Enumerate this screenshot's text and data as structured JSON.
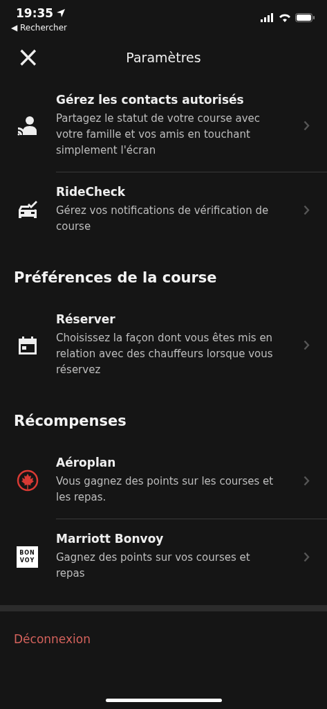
{
  "status_bar": {
    "time": "19:35",
    "back_label": "◀ Rechercher"
  },
  "header": {
    "close": "×",
    "title": "Paramètres"
  },
  "sections": [
    {
      "items": [
        {
          "kind": "contacts",
          "title": "Gérez les contacts autorisés",
          "description": "Partagez le statut de votre course avec votre famille et vos amis en touchant simplement l'écran"
        },
        {
          "kind": "car_check",
          "title": "RideCheck",
          "description": "Gérez vos notifications de vérification de course"
        }
      ]
    },
    {
      "heading": "Préférences de la course",
      "items": [
        {
          "kind": "calendar",
          "title": "Réserver",
          "description": "Choisissez la façon dont vous êtes mis en relation avec des chauffeurs lorsque vous réservez"
        }
      ]
    },
    {
      "heading": "Récompenses",
      "items": [
        {
          "kind": "maple",
          "title": "Aéroplan",
          "description": "Vous gagnez des points sur les courses et les repas."
        },
        {
          "kind": "bonvoy",
          "logo_text": [
            "BON",
            "VOY"
          ],
          "title": "Marriott Bonvoy",
          "description": "Gagnez des points sur vos courses et repas"
        }
      ]
    }
  ],
  "logout": "Déconnexion"
}
